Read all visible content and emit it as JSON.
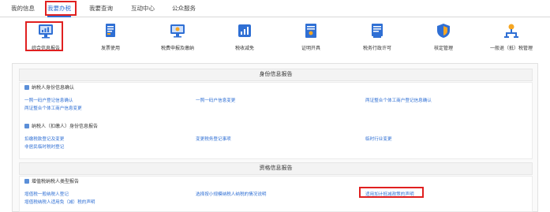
{
  "nav": {
    "tabs": [
      {
        "label": "我的信息"
      },
      {
        "label": "我要办税"
      },
      {
        "label": "我要查询"
      },
      {
        "label": "互动中心"
      },
      {
        "label": "公众服务"
      }
    ]
  },
  "functions": [
    {
      "label": "综合信息报告",
      "icon": "report-icon",
      "color": "#2f6fd4"
    },
    {
      "label": "发票使用",
      "icon": "invoice-icon",
      "color": "#2f6fd4"
    },
    {
      "label": "税费申报及缴纳",
      "icon": "declare-icon",
      "color": "#2f6fd4"
    },
    {
      "label": "税收减免",
      "icon": "tax-relief-icon",
      "color": "#2f6fd4"
    },
    {
      "label": "证明开具",
      "icon": "certificate-icon",
      "color": "#2f6fd4"
    },
    {
      "label": "税务行政许可",
      "icon": "license-icon",
      "color": "#2f6fd4"
    },
    {
      "label": "核定管理",
      "icon": "shield-icon",
      "color": "#2f6fd4"
    },
    {
      "label": "一般退（抵）税管理",
      "icon": "refund-icon",
      "color": "#2f6fd4"
    }
  ],
  "sections": {
    "identity": {
      "title": "身份信息报告",
      "group1": {
        "title": "纳税人身份信息确认",
        "links": [
          "一照一码户登记信息确认",
          "一照一码户信息变更",
          "两证整合个体工商户登记信息确认",
          "两证整合个体工商户信息变更"
        ]
      },
      "group2": {
        "title": "纳税人（扣缴人）身份信息报告",
        "links": [
          "扣缴税款登记及变更",
          "变更税务登记事项",
          "临时行业变更",
          "非居民临时税时登记"
        ]
      }
    },
    "qualification": {
      "title": "资格信息报告",
      "group1": {
        "title": "增值税纳税人类型报告",
        "links": [
          "增值税一般纳税人登记",
          "选择按小规模纳税人纳税的情况说明",
          "适用加计抵减政策的声明",
          "增值税纳税人适用免（减）税的声明"
        ]
      }
    }
  }
}
